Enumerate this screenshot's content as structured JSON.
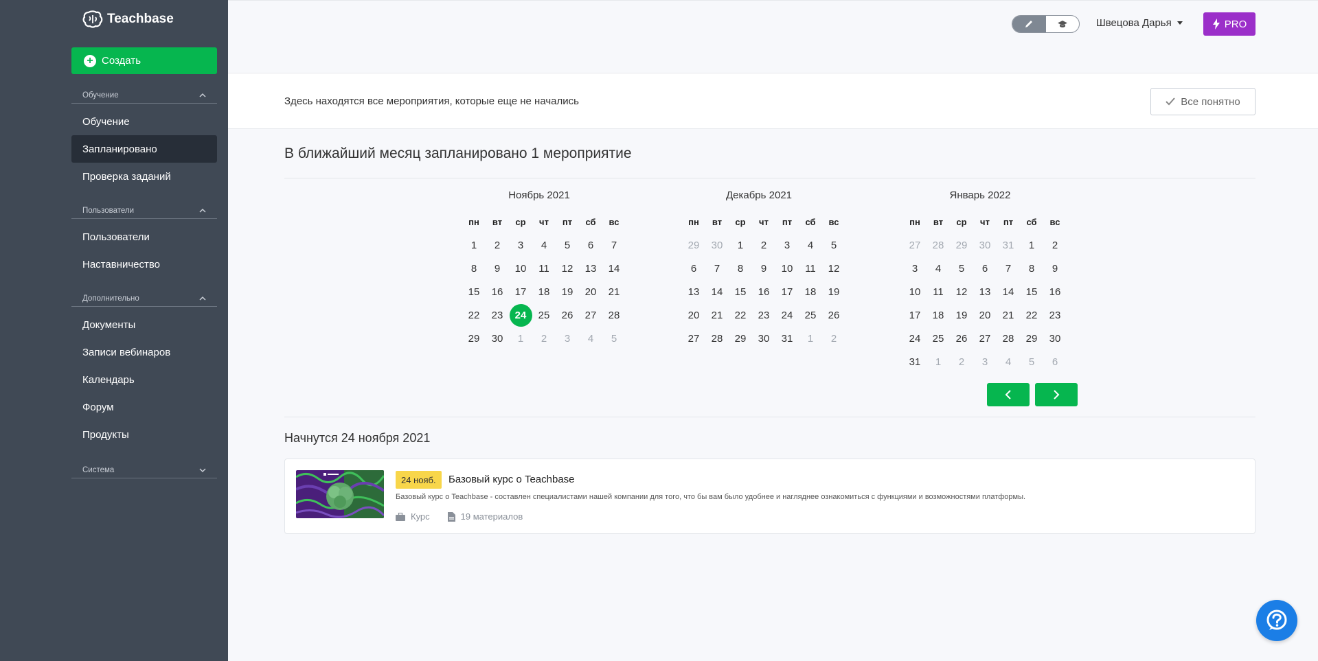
{
  "app": {
    "name": "Teachbase"
  },
  "sidebar": {
    "create_label": "Создать",
    "sections": [
      {
        "title": "Обучение",
        "expanded": true,
        "items": [
          "Обучение",
          "Запланировано",
          "Проверка заданий"
        ]
      },
      {
        "title": "Пользователи",
        "expanded": true,
        "items": [
          "Пользователи",
          "Наставничество"
        ]
      },
      {
        "title": "Дополнительно",
        "expanded": true,
        "items": [
          "Документы",
          "Записи вебинаров",
          "Календарь",
          "Форум",
          "Продукты"
        ]
      },
      {
        "title": "Система",
        "expanded": false,
        "items": []
      }
    ],
    "active_item": "Запланировано"
  },
  "topbar": {
    "mode_icons": [
      "pencil-icon",
      "graduation-cap-icon"
    ],
    "user_name": "Швецова Дарья",
    "pro_label": "PRO"
  },
  "banner": {
    "text": "Здесь находятся все мероприятия, которые еще не начались",
    "ok_label": "Все понятно"
  },
  "main": {
    "headline": "В ближайший месяц запланировано 1 мероприятие",
    "weekdays": [
      "пн",
      "вт",
      "ср",
      "чт",
      "пт",
      "сб",
      "вс"
    ],
    "months": [
      {
        "title": "Ноябрь 2021",
        "weeks": [
          [
            [
              "1",
              0
            ],
            [
              "2",
              0
            ],
            [
              "3",
              0
            ],
            [
              "4",
              0
            ],
            [
              "5",
              0
            ],
            [
              "6",
              0
            ],
            [
              "7",
              0
            ]
          ],
          [
            [
              "8",
              0
            ],
            [
              "9",
              0
            ],
            [
              "10",
              0
            ],
            [
              "11",
              0
            ],
            [
              "12",
              0
            ],
            [
              "13",
              0
            ],
            [
              "14",
              0
            ]
          ],
          [
            [
              "15",
              0
            ],
            [
              "16",
              0
            ],
            [
              "17",
              0
            ],
            [
              "18",
              0
            ],
            [
              "19",
              0
            ],
            [
              "20",
              0
            ],
            [
              "21",
              0
            ]
          ],
          [
            [
              "22",
              0
            ],
            [
              "23",
              0
            ],
            [
              "24",
              2
            ],
            [
              "25",
              0
            ],
            [
              "26",
              0
            ],
            [
              "27",
              0
            ],
            [
              "28",
              0
            ]
          ],
          [
            [
              "29",
              0
            ],
            [
              "30",
              0
            ],
            [
              "1",
              1
            ],
            [
              "2",
              1
            ],
            [
              "3",
              1
            ],
            [
              "4",
              1
            ],
            [
              "5",
              1
            ]
          ]
        ]
      },
      {
        "title": "Декабрь 2021",
        "weeks": [
          [
            [
              "29",
              1
            ],
            [
              "30",
              1
            ],
            [
              "1",
              0
            ],
            [
              "2",
              0
            ],
            [
              "3",
              0
            ],
            [
              "4",
              0
            ],
            [
              "5",
              0
            ]
          ],
          [
            [
              "6",
              0
            ],
            [
              "7",
              0
            ],
            [
              "8",
              0
            ],
            [
              "9",
              0
            ],
            [
              "10",
              0
            ],
            [
              "11",
              0
            ],
            [
              "12",
              0
            ]
          ],
          [
            [
              "13",
              0
            ],
            [
              "14",
              0
            ],
            [
              "15",
              0
            ],
            [
              "16",
              0
            ],
            [
              "17",
              0
            ],
            [
              "18",
              0
            ],
            [
              "19",
              0
            ]
          ],
          [
            [
              "20",
              0
            ],
            [
              "21",
              0
            ],
            [
              "22",
              0
            ],
            [
              "23",
              0
            ],
            [
              "24",
              0
            ],
            [
              "25",
              0
            ],
            [
              "26",
              0
            ]
          ],
          [
            [
              "27",
              0
            ],
            [
              "28",
              0
            ],
            [
              "29",
              0
            ],
            [
              "30",
              0
            ],
            [
              "31",
              0
            ],
            [
              "1",
              1
            ],
            [
              "2",
              1
            ]
          ]
        ]
      },
      {
        "title": "Январь 2022",
        "weeks": [
          [
            [
              "27",
              1
            ],
            [
              "28",
              1
            ],
            [
              "29",
              1
            ],
            [
              "30",
              1
            ],
            [
              "31",
              1
            ],
            [
              "1",
              0
            ],
            [
              "2",
              0
            ]
          ],
          [
            [
              "3",
              0
            ],
            [
              "4",
              0
            ],
            [
              "5",
              0
            ],
            [
              "6",
              0
            ],
            [
              "7",
              0
            ],
            [
              "8",
              0
            ],
            [
              "9",
              0
            ]
          ],
          [
            [
              "10",
              0
            ],
            [
              "11",
              0
            ],
            [
              "12",
              0
            ],
            [
              "13",
              0
            ],
            [
              "14",
              0
            ],
            [
              "15",
              0
            ],
            [
              "16",
              0
            ]
          ],
          [
            [
              "17",
              0
            ],
            [
              "18",
              0
            ],
            [
              "19",
              0
            ],
            [
              "20",
              0
            ],
            [
              "21",
              0
            ],
            [
              "22",
              0
            ],
            [
              "23",
              0
            ]
          ],
          [
            [
              "24",
              0
            ],
            [
              "25",
              0
            ],
            [
              "26",
              0
            ],
            [
              "27",
              0
            ],
            [
              "28",
              0
            ],
            [
              "29",
              0
            ],
            [
              "30",
              0
            ]
          ],
          [
            [
              "31",
              0
            ],
            [
              "1",
              1
            ],
            [
              "2",
              1
            ],
            [
              "3",
              1
            ],
            [
              "4",
              1
            ],
            [
              "5",
              1
            ],
            [
              "6",
              1
            ]
          ]
        ]
      }
    ],
    "subhead": "Начнутся 24 ноября 2021",
    "event": {
      "date_badge": "24 нояб.",
      "title": "Базовый курс о Teachbase",
      "description": "Базовый курс о Teachbase - составлен специалистами нашей компании для того, что бы вам было удобнее и нагляднее ознакомиться с функциями и возможностями платформы.",
      "type": "Курс",
      "materials": "19 материалов"
    }
  },
  "colors": {
    "accent": "#06b64f",
    "sidebar": "#404955",
    "pro": "#9b2fc9",
    "badge": "#f8d64a",
    "help": "#1b7ee6"
  }
}
